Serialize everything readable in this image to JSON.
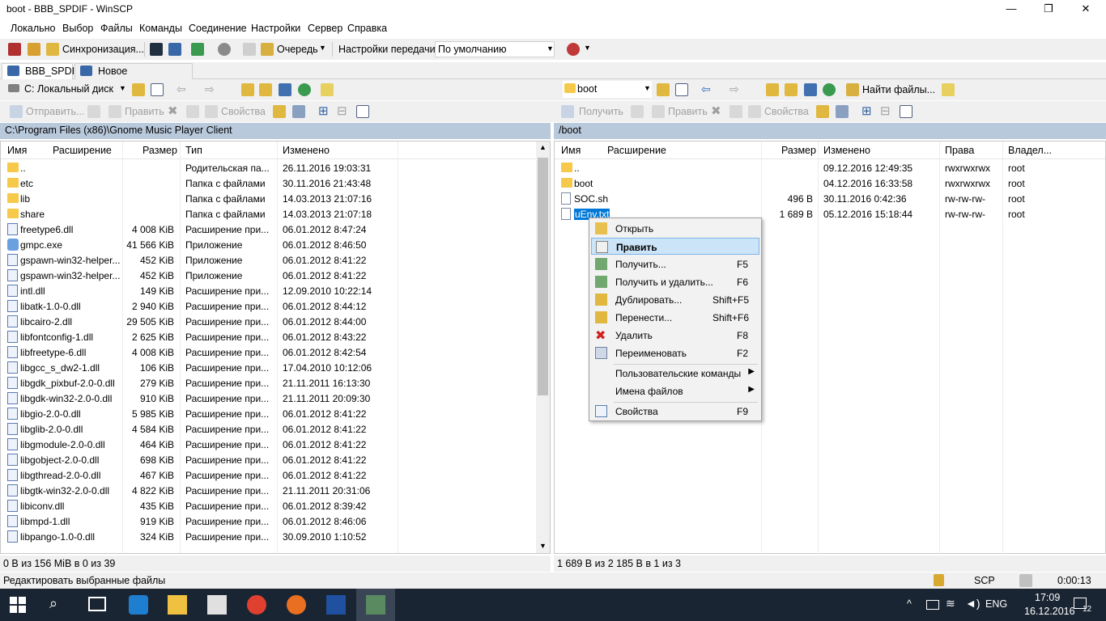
{
  "window": {
    "title": "boot - BBB_SPDIF - WinSCP",
    "min": "—",
    "max": "❐",
    "close": "✕"
  },
  "menu": [
    "Локально",
    "Выбор",
    "Файлы",
    "Команды",
    "Соединение",
    "Настройки",
    "Сервер",
    "Справка"
  ],
  "toolbar": {
    "sync": "Синхронизация...",
    "queue": "Очередь",
    "transfer_settings": "Настройки передачи",
    "transfer_value": "По умолчанию"
  },
  "tabs": {
    "session": "BBB_SPDIF",
    "new": "Новое соединение..."
  },
  "left": {
    "drive": "C: Локальный диск",
    "actions": {
      "send": "Отправить...",
      "edit": "Править",
      "props": "Свойства"
    },
    "path": "C:\\Program Files (x86)\\Gnome Music Player Client",
    "headers": {
      "name": "Имя",
      "ext": "Расширение",
      "size": "Размер",
      "type": "Тип",
      "changed": "Изменено"
    },
    "rows": [
      {
        "name": "..",
        "size": "",
        "type": "Родительская па...",
        "date": "26.11.2016  19:03:31",
        "kind": "up"
      },
      {
        "name": "etc",
        "size": "",
        "type": "Папка с файлами",
        "date": "30.11.2016  21:43:48",
        "kind": "folder"
      },
      {
        "name": "lib",
        "size": "",
        "type": "Папка с файлами",
        "date": "14.03.2013  21:07:16",
        "kind": "folder"
      },
      {
        "name": "share",
        "size": "",
        "type": "Папка с файлами",
        "date": "14.03.2013  21:07:18",
        "kind": "folder"
      },
      {
        "name": "freetype6.dll",
        "size": "4 008 KiB",
        "type": "Расширение при...",
        "date": "06.01.2012  8:47:24",
        "kind": "dll"
      },
      {
        "name": "gmpc.exe",
        "size": "41 566 KiB",
        "type": "Приложение",
        "date": "06.01.2012  8:46:50",
        "kind": "exe"
      },
      {
        "name": "gspawn-win32-helper...",
        "size": "452 KiB",
        "type": "Приложение",
        "date": "06.01.2012  8:41:22",
        "kind": "dll"
      },
      {
        "name": "gspawn-win32-helper...",
        "size": "452 KiB",
        "type": "Приложение",
        "date": "06.01.2012  8:41:22",
        "kind": "dll"
      },
      {
        "name": "intl.dll",
        "size": "149 KiB",
        "type": "Расширение при...",
        "date": "12.09.2010  10:22:14",
        "kind": "dll"
      },
      {
        "name": "libatk-1.0-0.dll",
        "size": "2 940 KiB",
        "type": "Расширение при...",
        "date": "06.01.2012  8:44:12",
        "kind": "dll"
      },
      {
        "name": "libcairo-2.dll",
        "size": "29 505 KiB",
        "type": "Расширение при...",
        "date": "06.01.2012  8:44:00",
        "kind": "dll"
      },
      {
        "name": "libfontconfig-1.dll",
        "size": "2 625 KiB",
        "type": "Расширение при...",
        "date": "06.01.2012  8:43:22",
        "kind": "dll"
      },
      {
        "name": "libfreetype-6.dll",
        "size": "4 008 KiB",
        "type": "Расширение при...",
        "date": "06.01.2012  8:42:54",
        "kind": "dll"
      },
      {
        "name": "libgcc_s_dw2-1.dll",
        "size": "106 KiB",
        "type": "Расширение при...",
        "date": "17.04.2010  10:12:06",
        "kind": "dll"
      },
      {
        "name": "libgdk_pixbuf-2.0-0.dll",
        "size": "279 KiB",
        "type": "Расширение при...",
        "date": "21.11.2011  16:13:30",
        "kind": "dll"
      },
      {
        "name": "libgdk-win32-2.0-0.dll",
        "size": "910 KiB",
        "type": "Расширение при...",
        "date": "21.11.2011  20:09:30",
        "kind": "dll"
      },
      {
        "name": "libgio-2.0-0.dll",
        "size": "5 985 KiB",
        "type": "Расширение при...",
        "date": "06.01.2012  8:41:22",
        "kind": "dll"
      },
      {
        "name": "libglib-2.0-0.dll",
        "size": "4 584 KiB",
        "type": "Расширение при...",
        "date": "06.01.2012  8:41:22",
        "kind": "dll"
      },
      {
        "name": "libgmodule-2.0-0.dll",
        "size": "464 KiB",
        "type": "Расширение при...",
        "date": "06.01.2012  8:41:22",
        "kind": "dll"
      },
      {
        "name": "libgobject-2.0-0.dll",
        "size": "698 KiB",
        "type": "Расширение при...",
        "date": "06.01.2012  8:41:22",
        "kind": "dll"
      },
      {
        "name": "libgthread-2.0-0.dll",
        "size": "467 KiB",
        "type": "Расширение при...",
        "date": "06.01.2012  8:41:22",
        "kind": "dll"
      },
      {
        "name": "libgtk-win32-2.0-0.dll",
        "size": "4 822 KiB",
        "type": "Расширение при...",
        "date": "21.11.2011  20:31:06",
        "kind": "dll"
      },
      {
        "name": "libiconv.dll",
        "size": "435 KiB",
        "type": "Расширение при...",
        "date": "06.01.2012  8:39:42",
        "kind": "dll"
      },
      {
        "name": "libmpd-1.dll",
        "size": "919 KiB",
        "type": "Расширение при...",
        "date": "06.01.2012  8:46:06",
        "kind": "dll"
      },
      {
        "name": "libpango-1.0-0.dll",
        "size": "324 KiB",
        "type": "Расширение при...",
        "date": "30.09.2010  1:10:52",
        "kind": "dll"
      }
    ],
    "status": "0 B из 156 MiB в 0 из 39"
  },
  "right": {
    "dir": "boot",
    "find": "Найти файлы...",
    "actions": {
      "get": "Получить",
      "edit": "Править",
      "props": "Свойства"
    },
    "path": "/boot",
    "headers": {
      "name": "Имя",
      "ext": "Расширение",
      "size": "Размер",
      "changed": "Изменено",
      "rights": "Права",
      "owner": "Владел..."
    },
    "rows": [
      {
        "name": "..",
        "size": "",
        "date": "09.12.2016 12:49:35",
        "rights": "rwxrwxrwx",
        "owner": "root",
        "kind": "up"
      },
      {
        "name": "boot",
        "size": "",
        "date": "04.12.2016 16:33:58",
        "rights": "rwxrwxrwx",
        "owner": "root",
        "kind": "folder"
      },
      {
        "name": "SOC.sh",
        "size": "496 B",
        "date": "30.11.2016 0:42:36",
        "rights": "rw-rw-rw-",
        "owner": "root",
        "kind": "file"
      },
      {
        "name": "uEnv.txt",
        "size": "1 689 B",
        "date": "05.12.2016 15:18:44",
        "rights": "rw-rw-rw-",
        "owner": "root",
        "kind": "file"
      }
    ],
    "status": "1 689 B из 2 185 B в 1 из 3"
  },
  "context_menu": [
    {
      "label": "Открыть",
      "shortcut": "",
      "icon": "folder-open-icon"
    },
    {
      "label": "Править",
      "shortcut": "",
      "icon": "edit-icon",
      "selected": true
    },
    {
      "label": "Получить...",
      "shortcut": "F5",
      "icon": "download-icon"
    },
    {
      "label": "Получить и удалить...",
      "shortcut": "F6",
      "icon": "download-move-icon"
    },
    {
      "label": "Дублировать...",
      "shortcut": "Shift+F5",
      "icon": "duplicate-icon"
    },
    {
      "label": "Перенести...",
      "shortcut": "Shift+F6",
      "icon": "move-icon"
    },
    {
      "label": "Удалить",
      "shortcut": "F8",
      "icon": "delete-icon"
    },
    {
      "label": "Переименовать",
      "shortcut": "F2",
      "icon": "rename-icon"
    },
    {
      "label": "Пользовательские команды",
      "shortcut": "",
      "submenu": true
    },
    {
      "label": "Имена файлов",
      "shortcut": "",
      "submenu": true
    },
    {
      "label": "Свойства",
      "shortcut": "F9",
      "icon": "properties-icon"
    }
  ],
  "statusbar": {
    "hint": "Редактировать выбранные файлы",
    "protocol": "SCP",
    "time": "0:00:13"
  },
  "taskbar": {
    "lang": "ENG",
    "clock": "17:09",
    "date": "16.12.2016",
    "notif": "12"
  }
}
